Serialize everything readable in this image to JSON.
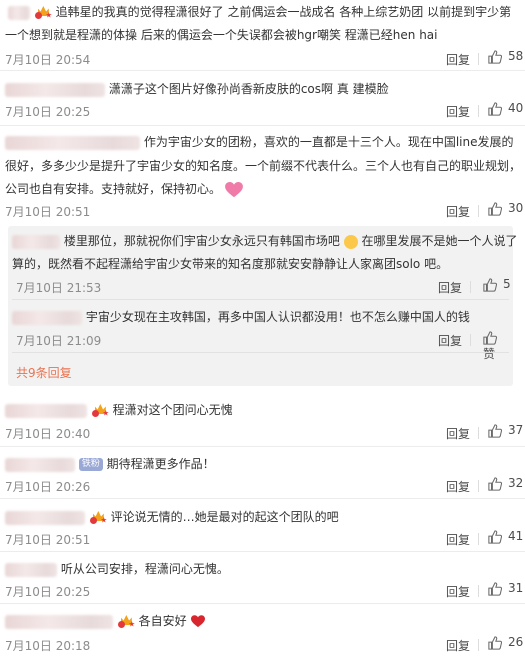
{
  "comments": [
    {
      "text_line1": "追韩星的我真的觉得程潇很好了 之前偶运会一战成名 各种上综艺奶团 以前提到宇少第",
      "text_line2": "一个想到就是程潇的体操 后来的偶运会一个失误都会被hgr嘲笑 程潇已经hen hai",
      "time": "7月10日 20:54",
      "reply": "回复",
      "likes": "58"
    },
    {
      "text": "潇潇子这个图片好像孙尚香新皮肤的cos啊 真 建模脸",
      "time": "7月10日 20:25",
      "reply": "回复",
      "likes": "40"
    },
    {
      "text_line1": "作为宇宙少女的团粉，喜欢的一直都是十三个人。现在中国line发展的",
      "text_line2": "很好，多多少少是提升了宇宙少女的知名度。一个前缀不代表什么。三个人也有自己的职业规划，",
      "text_line3": "公司也自有安排。支持就好，保持初心。",
      "time": "7月10日 20:51",
      "reply": "回复",
      "likes": "30"
    },
    {
      "text": "程潇对这个团问心无愧",
      "time": "7月10日 20:40",
      "reply": "回复",
      "likes": "37"
    },
    {
      "badge": "铁粉",
      "text": "期待程潇更多作品！",
      "time": "7月10日 20:26",
      "reply": "回复",
      "likes": "32"
    },
    {
      "text": "评论说无情的…她是最对的起这个团队的吧",
      "time": "7月10日 20:51",
      "reply": "回复",
      "likes": "41"
    },
    {
      "text": "听从公司安排，程潇问心无愧。",
      "time": "7月10日 20:25",
      "reply": "回复",
      "likes": "31"
    },
    {
      "text": "各自安好",
      "time": "7月10日 20:18",
      "reply": "回复",
      "likes": "26"
    }
  ],
  "replies": [
    {
      "text_line1": "楼里那位，那就祝你们宇宙少女永远只有韩国市场吧",
      "text_line1b": "在哪里发展不是她一个人说了",
      "text_line2": "算的，既然看不起程潇给宇宙少女带来的知名度那就安安静静让人家离团solo 吧。",
      "time": "7月10日 21:53",
      "reply": "回复",
      "likes": "5"
    },
    {
      "text": "宇宙少女现在主攻韩国，再多中国人认识都没用！也不怎么赚中国人的钱",
      "time": "7月10日 21:09",
      "reply": "回复",
      "likes": "赞"
    }
  ],
  "more_replies": "共9条回复",
  "colors": {
    "accent": "#eb7350",
    "meta": "#8c8c8c",
    "reply_bg": "#f2f2f2"
  },
  "icons": {
    "like": "thumbs-up-icon",
    "badge": "crown-badge-icon",
    "smile": "smile-emoji-icon",
    "heart": "heart-emoji-icon"
  }
}
